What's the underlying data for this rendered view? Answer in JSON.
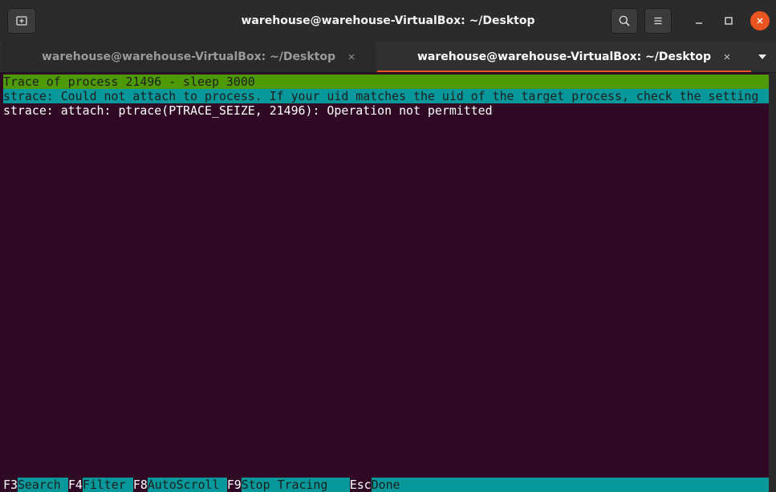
{
  "window": {
    "title": "warehouse@warehouse-VirtualBox: ~/Desktop"
  },
  "tabs": [
    {
      "label": "warehouse@warehouse-VirtualBox: ~/Desktop",
      "active": false
    },
    {
      "label": "warehouse@warehouse-VirtualBox: ~/Desktop",
      "active": true
    }
  ],
  "terminal": {
    "lines": [
      "Trace of process 21496 - sleep 3000",
      "strace: Could not attach to process. If your uid matches the uid of the target process, check the setting",
      "strace: attach: ptrace(PTRACE_SEIZE, 21496): Operation not permitted"
    ],
    "function_keys": [
      {
        "key": "F3",
        "label": "Search"
      },
      {
        "key": "F4",
        "label": "Filter"
      },
      {
        "key": "F8",
        "label": "AutoScroll"
      },
      {
        "key": "F9",
        "label": "Stop Tracing"
      },
      {
        "key": "Esc",
        "label": "Done"
      }
    ]
  },
  "colors": {
    "terminal_bg": "#300a24",
    "accent": "#e95420",
    "highlight_green": "#4e9a06",
    "highlight_cyan": "#06989a"
  },
  "icons": {
    "new_tab": "new-tab-icon",
    "search": "search-icon",
    "menu": "hamburger-menu-icon",
    "minimize": "minimize-icon",
    "maximize": "maximize-icon",
    "close": "close-icon",
    "tab_close": "close-icon",
    "tabs_dropdown": "chevron-down-icon"
  }
}
